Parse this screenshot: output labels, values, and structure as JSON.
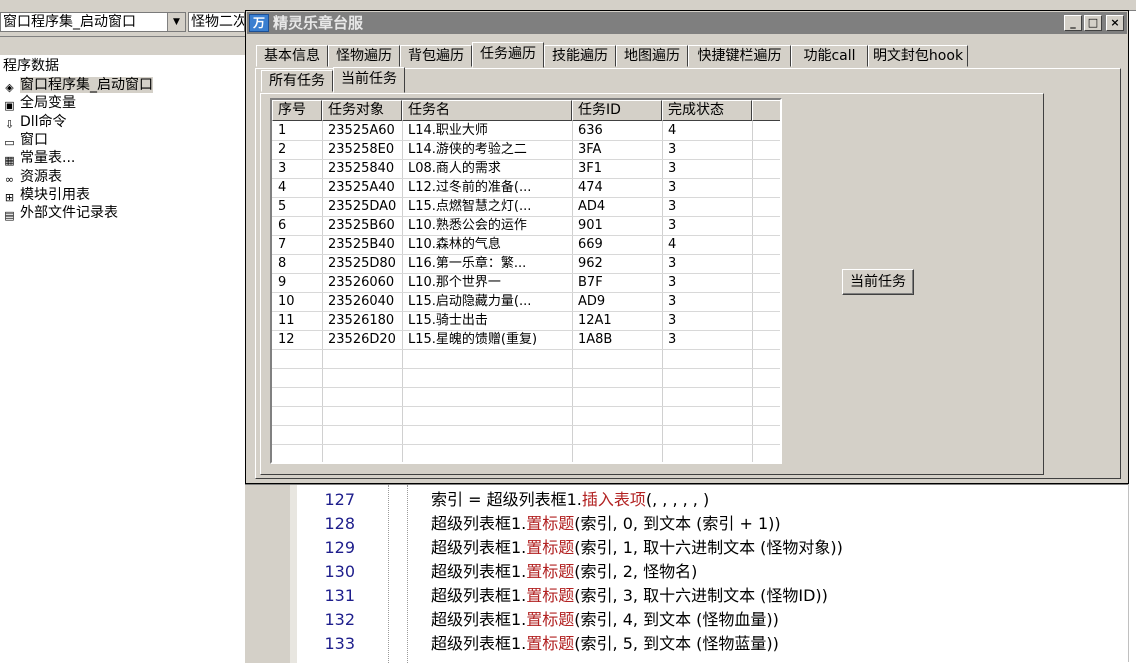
{
  "ide": {
    "combo_left": "窗口程序集_启动窗口",
    "combo_right": "怪物二次",
    "tree_root": "程序数据",
    "tree_items": [
      {
        "label": "窗口程序集_启动窗口",
        "icon": "module-icon",
        "glyph": "◈"
      },
      {
        "label": "全局变量",
        "icon": "global-var-icon",
        "glyph": "▣"
      },
      {
        "label": "Dll命令",
        "icon": "dll-icon",
        "glyph": "⇩"
      },
      {
        "label": "窗口",
        "icon": "window-icon",
        "glyph": "▭"
      },
      {
        "label": "常量表...",
        "icon": "constants-icon",
        "glyph": "▦"
      },
      {
        "label": "资源表",
        "icon": "resource-icon",
        "glyph": "∞"
      },
      {
        "label": "模块引用表",
        "icon": "module-ref-icon",
        "glyph": "⊞"
      },
      {
        "label": "外部文件记录表",
        "icon": "file-icon",
        "glyph": "▤"
      }
    ],
    "code_lines": [
      {
        "num": "127",
        "pre": "索引 = 超级列表框1.",
        "fn": "插入表项",
        "post": "(, , , , , )"
      },
      {
        "num": "128",
        "pre": "超级列表框1.",
        "fn": "置标题",
        "post": "(索引, 0, 到文本 (索引 + 1))"
      },
      {
        "num": "129",
        "pre": "超级列表框1.",
        "fn": "置标题",
        "post": "(索引, 1, 取十六进制文本 (怪物对象))"
      },
      {
        "num": "130",
        "pre": "超级列表框1.",
        "fn": "置标题",
        "post": "(索引, 2, 怪物名)"
      },
      {
        "num": "131",
        "pre": "超级列表框1.",
        "fn": "置标题",
        "post": "(索引, 3, 取十六进制文本 (怪物ID))"
      },
      {
        "num": "132",
        "pre": "超级列表框1.",
        "fn": "置标题",
        "post": "(索引, 4, 到文本 (怪物血量))"
      },
      {
        "num": "133",
        "pre": "超级列表框1.",
        "fn": "置标题",
        "post": "(索引, 5, 到文本 (怪物蓝量))"
      }
    ]
  },
  "window": {
    "title": "精灵乐章台服",
    "icon_glyph": "万",
    "caption_buttons": {
      "minimize": "_",
      "maximize": "□",
      "close": "×"
    },
    "tabs": [
      {
        "label": "基本信息",
        "active": false
      },
      {
        "label": "怪物遍历",
        "active": false
      },
      {
        "label": "背包遍历",
        "active": false
      },
      {
        "label": "任务遍历",
        "active": true
      },
      {
        "label": "技能遍历",
        "active": false
      },
      {
        "label": "地图遍历",
        "active": false
      },
      {
        "label": "快捷键栏遍历",
        "active": false
      },
      {
        "label": "功能call",
        "active": false
      },
      {
        "label": "明文封包hook",
        "active": false
      }
    ],
    "subtabs": [
      {
        "label": "所有任务",
        "active": false
      },
      {
        "label": "当前任务",
        "active": true
      }
    ],
    "table": {
      "columns": [
        "序号",
        "任务对象",
        "任务名",
        "任务ID",
        "完成状态"
      ],
      "rows": [
        [
          "1",
          "23525A60",
          "L14.职业大师",
          "636",
          "4"
        ],
        [
          "2",
          "235258E0",
          "L14.游侠的考验之二",
          "3FA",
          "3"
        ],
        [
          "3",
          "23525840",
          "L08.商人的需求",
          "3F1",
          "3"
        ],
        [
          "4",
          "23525A40",
          "L12.过冬前的准备(...",
          "474",
          "3"
        ],
        [
          "5",
          "23525DA0",
          "L15.点燃智慧之灯(...",
          "AD4",
          "3"
        ],
        [
          "6",
          "23525B60",
          "L10.熟悉公会的运作",
          "901",
          "3"
        ],
        [
          "7",
          "23525B40",
          "L10.森林的气息",
          "669",
          "4"
        ],
        [
          "8",
          "23525D80",
          "L16.第一乐章：繁...",
          "962",
          "3"
        ],
        [
          "9",
          "23526060",
          "L10.那个世界一",
          "B7F",
          "3"
        ],
        [
          "10",
          "23526040",
          "L15.启动隐藏力量(...",
          "AD9",
          "3"
        ],
        [
          "11",
          "23526180",
          "L15.骑士出击",
          "12A1",
          "3"
        ],
        [
          "12",
          "23526D20",
          "L15.星魄的馈赠(重复)",
          "1A8B",
          "3"
        ]
      ]
    },
    "button_current": "当前任务"
  }
}
